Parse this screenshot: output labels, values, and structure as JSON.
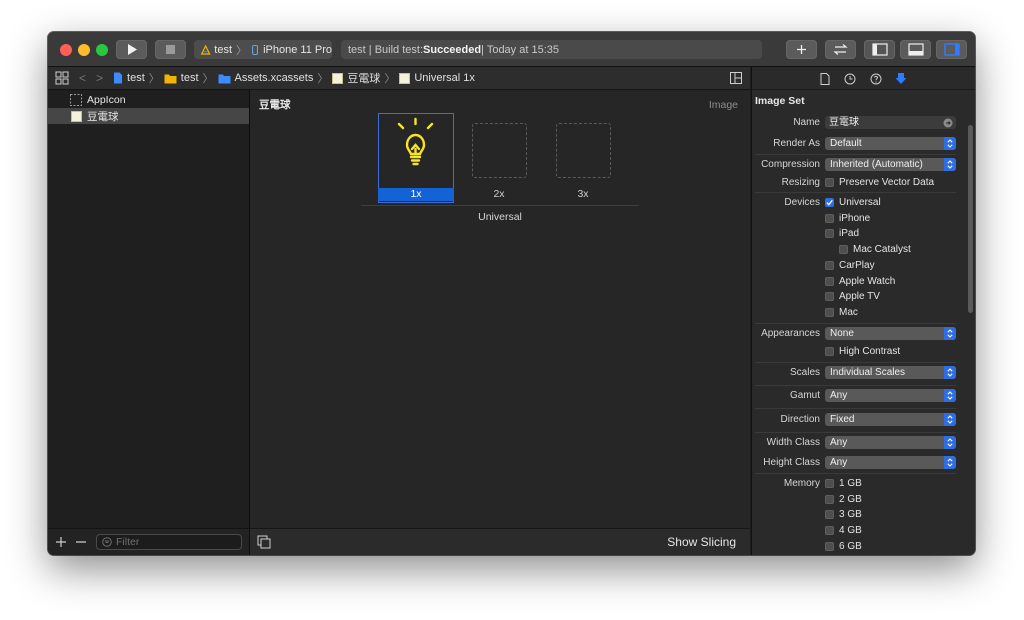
{
  "toolbar": {
    "scheme_name": "test",
    "device_name": "iPhone 11 Pro",
    "status_prefix": "test | Build test: ",
    "status_result": "Succeeded",
    "status_suffix": " | Today at 15:35"
  },
  "jumpbar": {
    "crumbs": [
      "test",
      "test",
      "Assets.xcassets",
      "豆電球",
      "Universal 1x"
    ]
  },
  "navigator": {
    "items": [
      "AppIcon",
      "豆電球"
    ],
    "filter_placeholder": "Filter"
  },
  "editor": {
    "asset_name": "豆電球",
    "kind": "Image",
    "slots": [
      "1x",
      "2x",
      "3x"
    ],
    "group_label": "Universal",
    "show_slicing": "Show Slicing",
    "accent": "#f7e61e"
  },
  "inspector": {
    "section": "Image Set",
    "name_label": "Name",
    "name_value": "豆電球",
    "render_as_label": "Render As",
    "render_as_value": "Default",
    "compression_label": "Compression",
    "compression_value": "Inherited (Automatic)",
    "resizing_label": "Resizing",
    "resizing_option": "Preserve Vector Data",
    "devices_label": "Devices",
    "devices": [
      "Universal",
      "iPhone",
      "iPad",
      "Mac Catalyst",
      "CarPlay",
      "Apple Watch",
      "Apple TV",
      "Mac"
    ],
    "appearances_label": "Appearances",
    "appearances_value": "None",
    "high_contrast": "High Contrast",
    "scales_label": "Scales",
    "scales_value": "Individual Scales",
    "gamut_label": "Gamut",
    "gamut_value": "Any",
    "direction_label": "Direction",
    "direction_value": "Fixed",
    "width_class_label": "Width Class",
    "width_class_value": "Any",
    "height_class_label": "Height Class",
    "height_class_value": "Any",
    "memory_label": "Memory",
    "memory": [
      "1 GB",
      "2 GB",
      "3 GB",
      "4 GB",
      "6 GB"
    ]
  }
}
